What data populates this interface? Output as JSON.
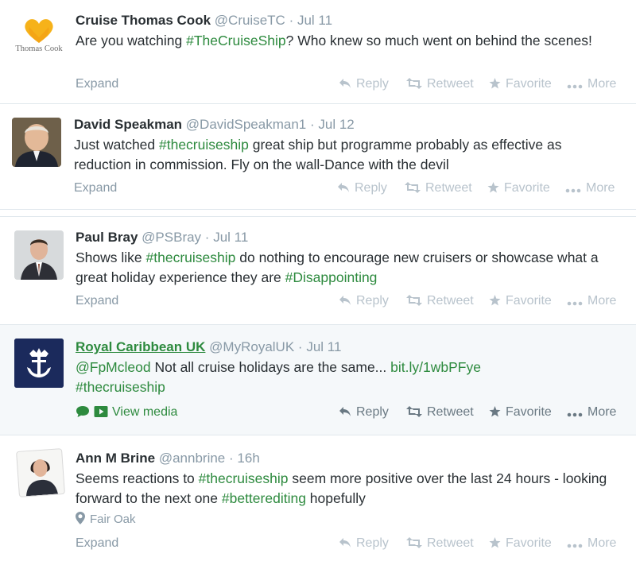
{
  "actions": {
    "reply": "Reply",
    "retweet": "Retweet",
    "favorite": "Favorite",
    "more": "More",
    "expand": "Expand",
    "view_media": "View media"
  },
  "colors": {
    "hashtag": "#2d8a3e",
    "muted": "#8899a6",
    "highlight_bg": "#f5f8fa"
  },
  "tweets": [
    {
      "name": "Cruise Thomas Cook",
      "handle": "@CruiseTC",
      "sep": "·",
      "time": "Jul 11",
      "avatar_label": "Thomas Cook",
      "t": [
        "Are you watching ",
        "#TheCruiseShip",
        "? Who knew so much went on behind the scenes!"
      ]
    },
    {
      "name": "David Speakman",
      "handle": "@DavidSpeakman1",
      "sep": "·",
      "time": "Jul 12",
      "t": [
        "Just watched ",
        "#thecruiseship",
        " great ship but programme probably as effective as reduction in commission. Fly on the wall-Dance with the devil"
      ]
    },
    {
      "name": "Paul Bray",
      "handle": "@PSBray",
      "sep": "·",
      "time": "Jul 11",
      "t": [
        "Shows like ",
        "#thecruiseship",
        " do nothing to encourage new cruisers or showcase what a great holiday experience they are ",
        "#Disappointing"
      ]
    },
    {
      "name": "Royal Caribbean UK",
      "handle": "@MyRoyalUK",
      "sep": "·",
      "time": "Jul 11",
      "t": [
        "@FpMcleod",
        " Not all cruise holidays are the same... ",
        "bit.ly/1wbPFye",
        " #thecruiseship"
      ]
    },
    {
      "name": "Ann M Brine",
      "handle": "@annbrine",
      "sep": "·",
      "time": "16h",
      "location": "Fair Oak",
      "t": [
        "Seems reactions to ",
        "#thecruiseship",
        " seem more positive over the last 24 hours - looking forward to the next one ",
        "#betterediting",
        " hopefully"
      ]
    }
  ]
}
